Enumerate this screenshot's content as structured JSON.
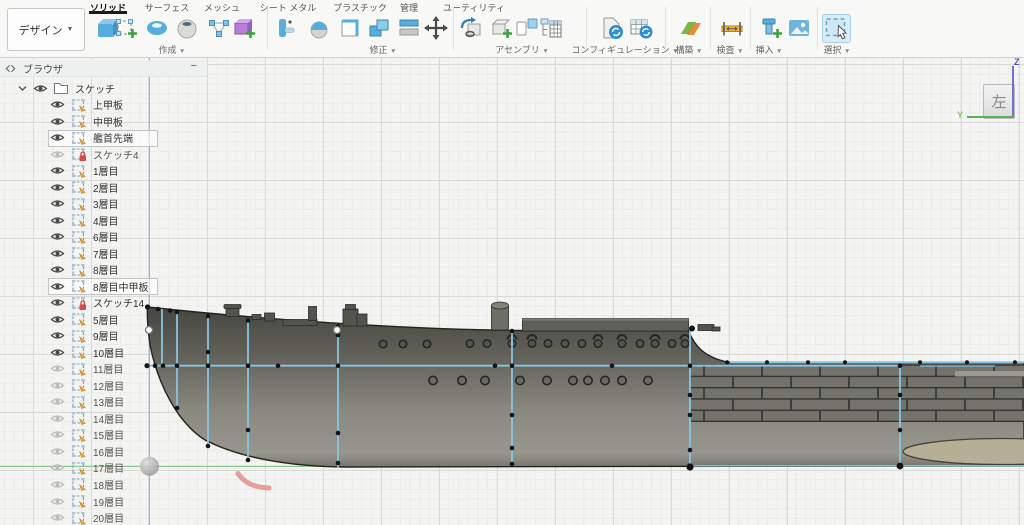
{
  "toolbar": {
    "design_menu": {
      "label": "デザイン"
    },
    "tabs": [
      {
        "label": "ソリッド",
        "active": true
      },
      {
        "label": "サーフェス",
        "active": false
      },
      {
        "label": "メッシュ",
        "active": false
      },
      {
        "label": "シート メタル",
        "active": false
      },
      {
        "label": "プラスチック",
        "active": false
      },
      {
        "label": "管理",
        "active": false
      },
      {
        "label": "ユーティリティ",
        "active": false
      }
    ],
    "panels": [
      {
        "label": "作成",
        "icons": [
          "extrude",
          "create-sketch",
          "revolve",
          "hole",
          "mesh-web",
          "primitive-box"
        ]
      },
      {
        "label": "修正",
        "icons": [
          "flange",
          "bend",
          "press-pull",
          "combine",
          "split",
          "move"
        ]
      },
      {
        "label": "アセンブリ",
        "icons": [
          "new-component",
          "insert-component",
          "joint",
          "bom-table"
        ]
      },
      {
        "label": "コンフィギュレーション",
        "icons": [
          "configure-design",
          "configure-table"
        ]
      },
      {
        "label": "構築",
        "icons": [
          "construct-plane"
        ]
      },
      {
        "label": "検査",
        "icons": [
          "measure"
        ]
      },
      {
        "label": "挿入",
        "icons": [
          "insert-fastener",
          "insert-canvas"
        ]
      },
      {
        "label": "選択",
        "icons": [
          "select-window"
        ],
        "active_tool": true
      }
    ]
  },
  "browser": {
    "title": "ブラウザ",
    "minimize_label": "−",
    "folder": {
      "label": "スケッチ",
      "visible": true,
      "expanded": true
    },
    "items": [
      {
        "label": "上甲板",
        "visible": true,
        "locked": false,
        "highlighted": false
      },
      {
        "label": "中甲板",
        "visible": true,
        "locked": false,
        "highlighted": false
      },
      {
        "label": "艦首先端",
        "visible": true,
        "locked": false,
        "highlighted": true
      },
      {
        "label": "スケッチ4",
        "visible": false,
        "locked": true,
        "highlighted": false
      },
      {
        "label": "1層目",
        "visible": true,
        "locked": false,
        "highlighted": false
      },
      {
        "label": "2層目",
        "visible": true,
        "locked": false,
        "highlighted": false
      },
      {
        "label": "3層目",
        "visible": true,
        "locked": false,
        "highlighted": false
      },
      {
        "label": "4層目",
        "visible": true,
        "locked": false,
        "highlighted": false
      },
      {
        "label": "6層目",
        "visible": true,
        "locked": false,
        "highlighted": false
      },
      {
        "label": "7層目",
        "visible": true,
        "locked": false,
        "highlighted": false
      },
      {
        "label": "8層目",
        "visible": true,
        "locked": false,
        "highlighted": false
      },
      {
        "label": "8層目中甲板",
        "visible": true,
        "locked": false,
        "highlighted": true
      },
      {
        "label": "スケッチ14",
        "visible": true,
        "locked": true,
        "highlighted": false
      },
      {
        "label": "5層目",
        "visible": true,
        "locked": false,
        "highlighted": false
      },
      {
        "label": "9層目",
        "visible": true,
        "locked": false,
        "highlighted": false
      },
      {
        "label": "10層目",
        "visible": true,
        "locked": false,
        "highlighted": false
      },
      {
        "label": "11層目",
        "visible": false,
        "locked": false,
        "highlighted": false
      },
      {
        "label": "12層目",
        "visible": false,
        "locked": false,
        "highlighted": false
      },
      {
        "label": "13層目",
        "visible": false,
        "locked": false,
        "highlighted": false
      },
      {
        "label": "14層目",
        "visible": false,
        "locked": false,
        "highlighted": false
      },
      {
        "label": "15層目",
        "visible": false,
        "locked": false,
        "highlighted": false
      },
      {
        "label": "16層目",
        "visible": false,
        "locked": false,
        "highlighted": false
      },
      {
        "label": "17層目",
        "visible": false,
        "locked": false,
        "highlighted": false
      },
      {
        "label": "18層目",
        "visible": false,
        "locked": false,
        "highlighted": false
      },
      {
        "label": "19層目",
        "visible": false,
        "locked": false,
        "highlighted": false
      },
      {
        "label": "20層目",
        "visible": false,
        "locked": false,
        "highlighted": false
      }
    ]
  },
  "viewcube": {
    "face": "左",
    "z_label": "Z",
    "y_label": "Y"
  },
  "colors": {
    "sketch_blue": "#85c6e4",
    "axis_green": "#56b456",
    "axis_purple": "#aaa5de",
    "highlight_pink": "#e09191",
    "hull_gray": "#6d6d66",
    "boat_tan": "#b7ae96"
  }
}
